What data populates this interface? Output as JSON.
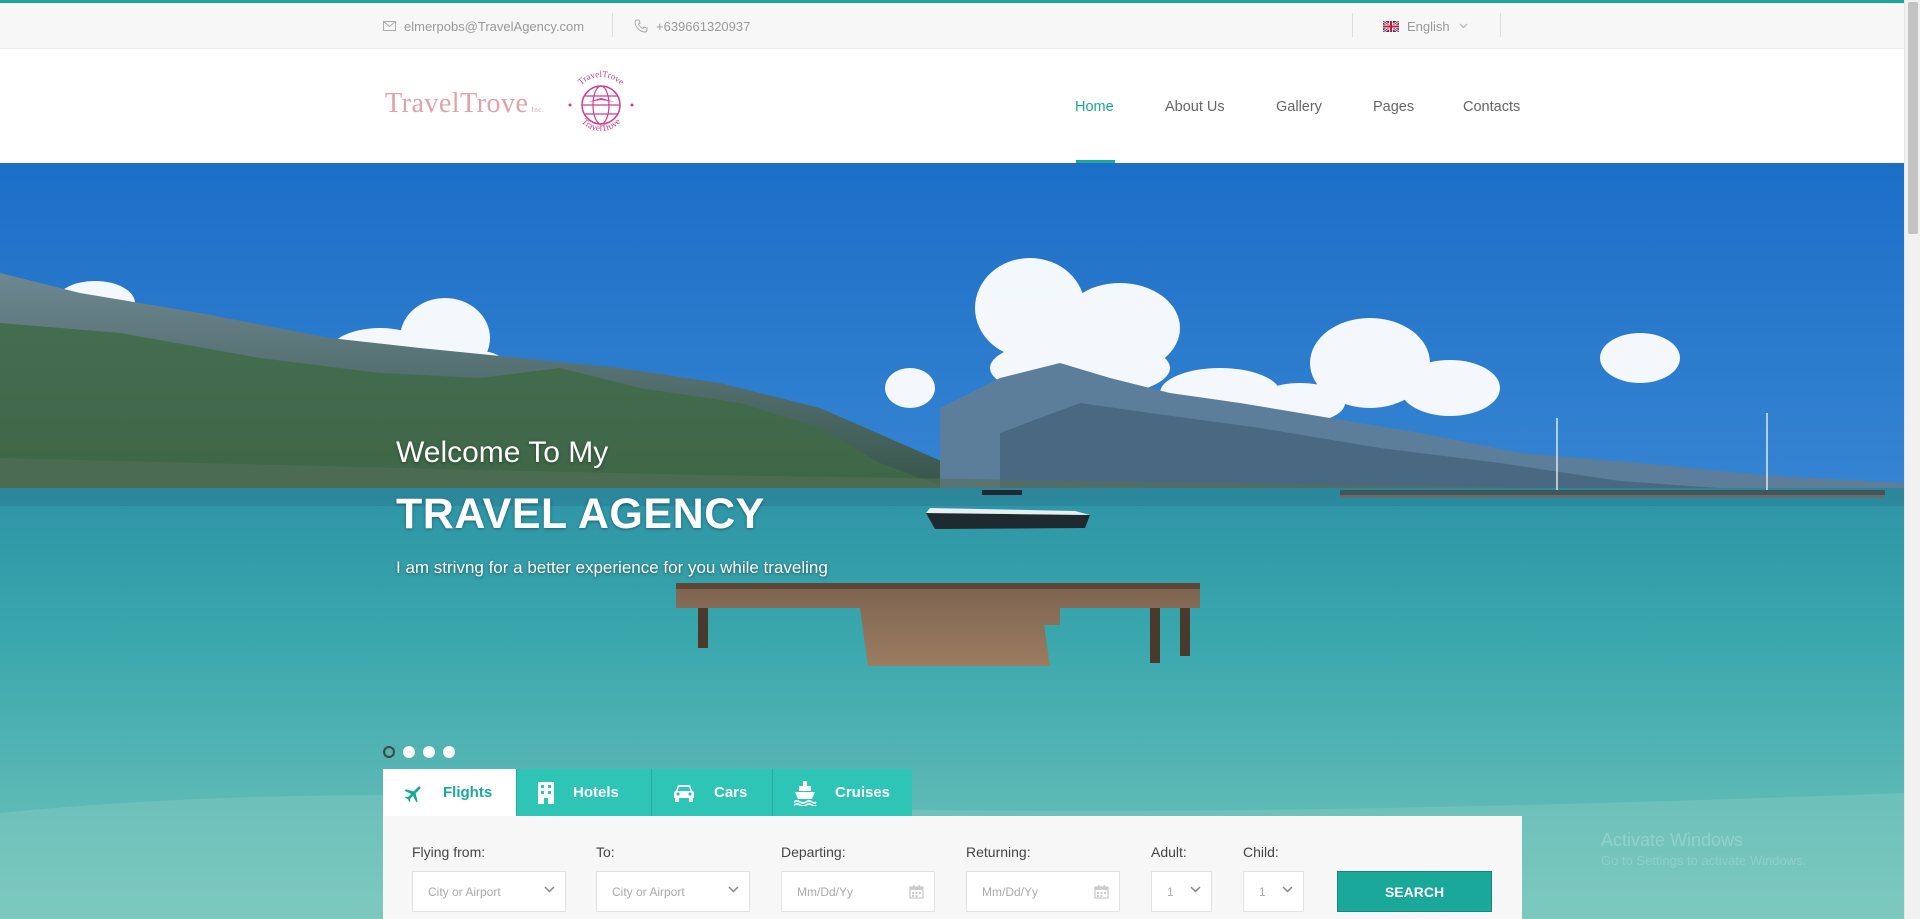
{
  "topbar": {
    "email": "elmerpobs@TravelAgency.com",
    "phone": "+639661320937",
    "language": "English",
    "icons": {
      "email": "envelope-icon",
      "phone": "phone-icon",
      "flag": "uk-flag-icon",
      "dropdown": "chevron-down-icon"
    }
  },
  "logo": {
    "name": "TravelTrove",
    "small": "Inc.",
    "seal_text": "TravelTrove"
  },
  "nav": {
    "home": "Home",
    "about": "About Us",
    "gallery": "Gallery",
    "pages": "Pages",
    "contacts": "Contacts",
    "active": "Home"
  },
  "hero": {
    "subtitle": "Welcome To My",
    "title": "TRAVEL AGENCY",
    "text": "I am strivng for a better experience for you while traveling",
    "slides": 4,
    "active_slide": 1
  },
  "tabs": {
    "flights": "Flights",
    "hotels": "Hotels",
    "cars": "Cars",
    "cruises": "Cruises",
    "active": "Flights"
  },
  "form": {
    "flying_from_label": "Flying from:",
    "flying_from_value": "City or Airport",
    "to_label": "To:",
    "to_value": "City or Airport",
    "departing_label": "Departing:",
    "departing_value": "Mm/Dd/Yy",
    "returning_label": "Returning:",
    "returning_value": "Mm/Dd/Yy",
    "adult_label": "Adult:",
    "adult_value": "1",
    "child_label": "Child:",
    "child_value": "1",
    "search_label": "SEARCH"
  },
  "watermark": {
    "line1": "Activate Windows",
    "line2": "Go to Settings to activate Windows."
  },
  "colors": {
    "accent": "#19a89a",
    "tab": "#2ec4b6",
    "logo": "#e0a3a8",
    "seal": "#d23c8c"
  }
}
